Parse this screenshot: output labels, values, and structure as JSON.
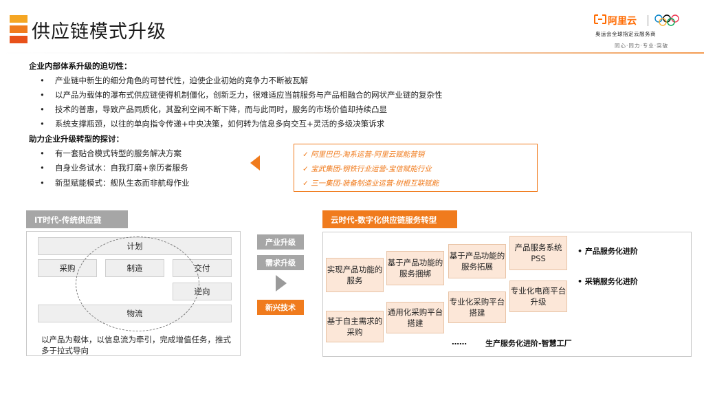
{
  "header": {
    "title": "供应链模式升级",
    "brand_logo": "阿里云",
    "brand_sub": "奥运会全球指定云服务商",
    "brand_motto": "同心·同力·专业·突破"
  },
  "section1": {
    "heading": "企业内部体系升级的迫切性：",
    "items": [
      "产业链中新生的细分角色的可替代性，迫使企业初始的竞争力不断被瓦解",
      "以产品为载体的瀑布式供应链使得机制僵化，创新乏力，很难适应当前服务与产品相融合的网状产业链的复杂性",
      "技术的普惠，导致产品同质化，其盈利空间不断下降，而与此同时，服务的市场价值却持续凸显",
      "系统支撑瓶颈，以往的单向指令传递+中央决策，如何转为信息多向交互+灵活的多级决策诉求"
    ]
  },
  "section2": {
    "heading": "助力企业升级转型的探讨：",
    "items": [
      "有一套贴合模式转型的服务解决方案",
      "自身业务试水：自我打磨+亲历者服务",
      "新型赋能模式：舰队生态而非航母作业"
    ]
  },
  "callout": {
    "items": [
      "✓  阿里巴巴-淘系运营-阿里云赋能营销",
      "✓  宝武集团-钢铁行业运营-宝信赋能行业",
      "✓  三一集团-装备制造业运营-树根互联赋能"
    ]
  },
  "left_panel": {
    "tag": "IT时代-传统供应链",
    "boxes": {
      "plan": "计划",
      "purchase": "采购",
      "manufacture": "制造",
      "deliver": "交付",
      "reverse": "逆向",
      "logistics": "物流"
    },
    "caption": "以产品为载体，以信息流为牵引，完成增值任务，推式多于拉式导向"
  },
  "middle": {
    "tag1": "产业升级",
    "tag2": "需求升级",
    "tag3": "新兴技术"
  },
  "right_panel": {
    "tag": "云时代-数字化供应链服务转型",
    "boxes": {
      "b1": "实现产品功能的服务",
      "b2": "基于产品功能的服务捆绑",
      "b3": "基于产品功能的服务拓展",
      "b4": "产品服务系统PSS",
      "b5": "基于自主需求的采购",
      "b6": "通用化采购平台搭建",
      "b7": "专业化采购平台搭建",
      "b8": "专业化电商平台升级"
    },
    "label1": "•  产品服务化进阶",
    "label2": "•  采销服务化进阶",
    "ellipsis": "……",
    "footer": "生产服务化进阶-智慧工厂"
  },
  "colors": {
    "accent": "#f07b1d",
    "gray_tag": "#a6a6a6",
    "light_orange": "#fce7d8"
  }
}
